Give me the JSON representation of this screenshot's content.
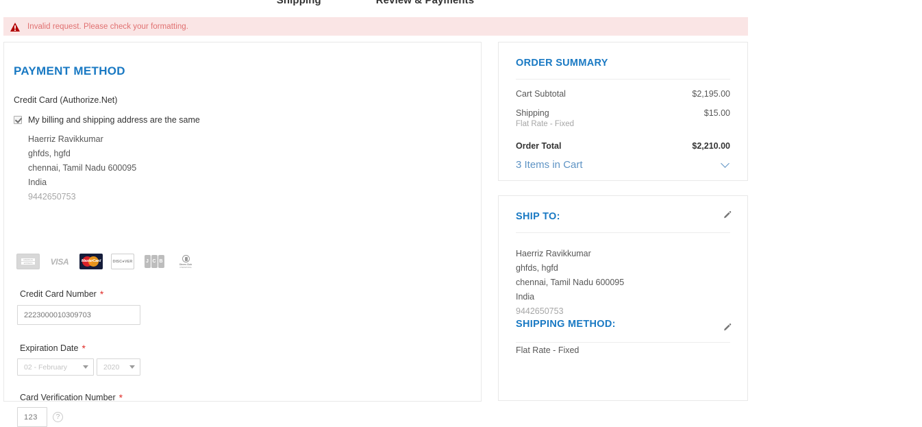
{
  "steps": [
    {
      "label": "Shipping"
    },
    {
      "label": "Review & Payments"
    }
  ],
  "error": {
    "icon": "warning-triangle-icon",
    "message": "Invalid request. Please check your formatting."
  },
  "payment": {
    "title": "PAYMENT METHOD",
    "method_name": "Credit Card (Authorize.Net)",
    "billing_same_label": "My billing and shipping address are the same",
    "billing_same_checked": true,
    "billing_address": [
      "Haerriz Ravikkumar",
      "ghfds, hgfd",
      "chennai, Tamil Nadu 600095",
      "India"
    ],
    "billing_phone": "9442650753",
    "accepted_cards": [
      {
        "name": "american-express",
        "label": "AMERICAN EXPRESS"
      },
      {
        "name": "visa",
        "label": "VISA"
      },
      {
        "name": "mastercard",
        "label": "MasterCard"
      },
      {
        "name": "discover",
        "label": "DISC VER"
      },
      {
        "name": "jcb",
        "label": "JCB"
      },
      {
        "name": "diners-club",
        "label": "Diners Club"
      }
    ],
    "card_number": {
      "label": "Credit Card Number",
      "required": "*",
      "value": "",
      "placeholder": "2223000010309703"
    },
    "expiration": {
      "label": "Expiration Date",
      "required": "*",
      "month": "02 - February",
      "year": "2020"
    },
    "cvn": {
      "label": "Card Verification Number",
      "required": "*",
      "value": "",
      "placeholder": "123",
      "help_icon": "question-mark-icon"
    }
  },
  "order_summary": {
    "title": "ORDER SUMMARY",
    "rows": [
      {
        "label": "Cart Subtotal",
        "sub": "",
        "value": "$2,195.00"
      },
      {
        "label": "Shipping",
        "sub": "Flat Rate - Fixed",
        "value": "$15.00"
      }
    ],
    "total_label": "Order Total",
    "total_value": "$2,210.00",
    "items_link": "3 Items in Cart"
  },
  "ship_to": {
    "title": "SHIP TO:",
    "edit_icon": "pencil-icon",
    "address": [
      "Haerriz Ravikkumar",
      "ghfds, hgfd",
      "chennai, Tamil Nadu 600095",
      "India"
    ],
    "phone": "9442650753"
  },
  "shipping_method": {
    "title": "SHIPPING METHOD:",
    "edit_icon": "pencil-icon",
    "value": "Flat Rate - Fixed"
  },
  "colors": {
    "accent_blue": "#1979c3",
    "link_blue": "#5e93c4",
    "error_bg": "#fae5e5",
    "error_text": "#e07070",
    "required_red": "#e02b27"
  }
}
